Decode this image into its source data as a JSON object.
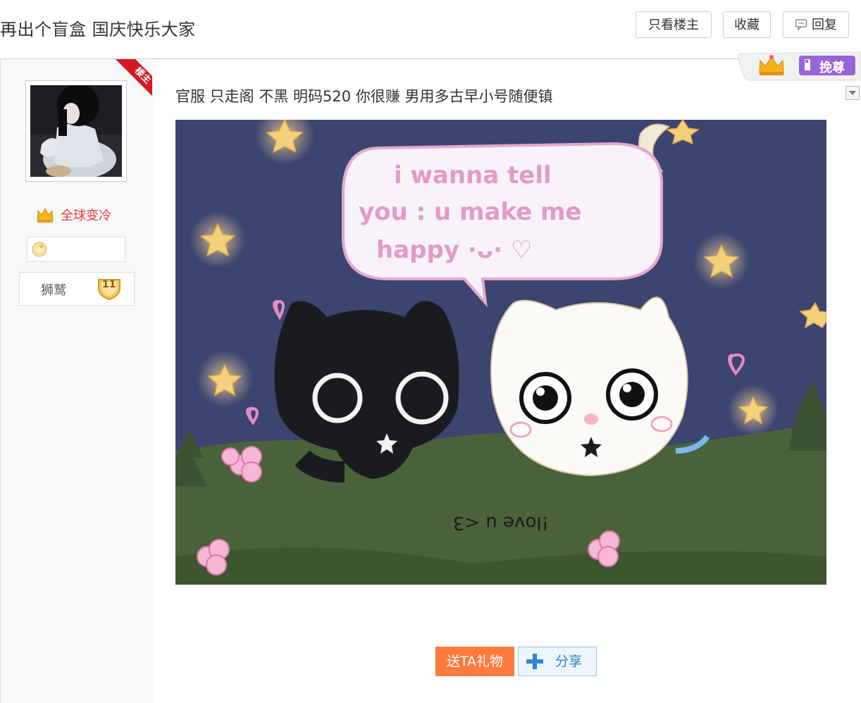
{
  "header": {
    "title": "再出个盲盒 国庆快乐大家",
    "buttons": {
      "only_op": "只看楼主",
      "favorite": "收藏",
      "reply": "回复"
    }
  },
  "sidebar": {
    "ribbon": "楼主",
    "username": "全球变冷",
    "forum_name": "狮鹫",
    "level": "11"
  },
  "post": {
    "text": "官服 只走阁 不黑 明码520 你很赚 男用多古早小号随便镇",
    "image_caption": "i wanna tell you : u make me happy ·ᴗ· ♡",
    "image_ground_text": "!love u <3",
    "honor_label": "挽尊"
  },
  "actions": {
    "gift": "送TA礼物",
    "share": "分享"
  },
  "colors": {
    "ribbon": "#d31a22",
    "username": "#e53b3b",
    "gift_button": "#ff7a3d",
    "share_text": "#2a7fd4",
    "honor_purple": "#9a63d6"
  }
}
